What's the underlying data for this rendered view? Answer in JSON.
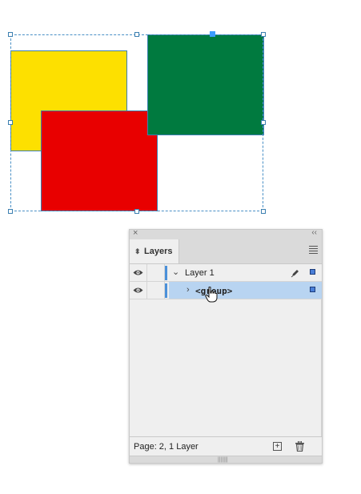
{
  "canvas": {
    "colors": {
      "yellow": "#fde000",
      "red": "#e80000",
      "green": "#007a3f",
      "selection": "#4a90c6"
    }
  },
  "layers_panel": {
    "tab_label": "Layers",
    "close_icon": "close-icon",
    "collapse_icon": "double-chevron-icon",
    "rows": [
      {
        "label": "Layer 1",
        "expanded": true
      },
      {
        "label": "<group>",
        "expanded": false,
        "selected": true
      }
    ],
    "footer": {
      "status": "Page: 2, 1 Layer"
    },
    "grip": "|||||||"
  }
}
